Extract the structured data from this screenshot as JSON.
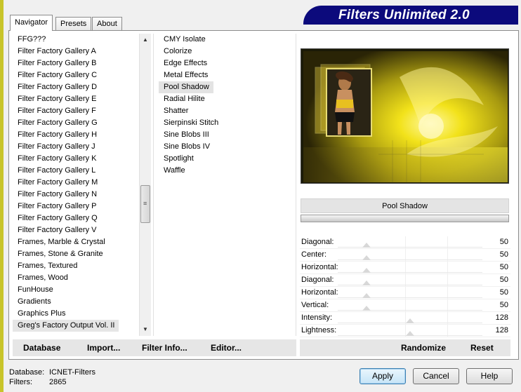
{
  "tabs": [
    "Navigator",
    "Presets",
    "About"
  ],
  "active_tab": "Navigator",
  "title": "Filters Unlimited 2.0",
  "categories": [
    "FFG???",
    "Filter Factory Gallery A",
    "Filter Factory Gallery B",
    "Filter Factory Gallery C",
    "Filter Factory Gallery D",
    "Filter Factory Gallery E",
    "Filter Factory Gallery F",
    "Filter Factory Gallery G",
    "Filter Factory Gallery H",
    "Filter Factory Gallery J",
    "Filter Factory Gallery K",
    "Filter Factory Gallery L",
    "Filter Factory Gallery M",
    "Filter Factory Gallery N",
    "Filter Factory Gallery P",
    "Filter Factory Gallery Q",
    "Filter Factory Gallery V",
    "Frames, Marble & Crystal",
    "Frames, Stone & Granite",
    "Frames, Textured",
    "Frames, Wood",
    "FunHouse",
    "Gradients",
    "Graphics Plus",
    "Greg's Factory Output Vol. II"
  ],
  "selected_category": "Greg's Factory Output Vol. II",
  "filters": [
    "CMY Isolate",
    "Colorize",
    "Edge Effects",
    "Metal Effects",
    "Pool Shadow",
    "Radial Hilite",
    "Shatter",
    "Sierpinski Stitch",
    "Sine Blobs III",
    "Sine Blobs IV",
    "Spotlight",
    "Waffle"
  ],
  "selected_filter": "Pool Shadow",
  "preview_filter_name": "Pool Shadow",
  "parameters": [
    {
      "label": "Diagonal:",
      "value": "50",
      "level": 0.2
    },
    {
      "label": "Center:",
      "value": "50",
      "level": 0.2
    },
    {
      "label": "Horizontal:",
      "value": "50",
      "level": 0.2
    },
    {
      "label": "Diagonal:",
      "value": "50",
      "level": 0.2
    },
    {
      "label": "Horizontal:",
      "value": "50",
      "level": 0.2
    },
    {
      "label": "Vertical:",
      "value": "50",
      "level": 0.2
    },
    {
      "label": "Intensity:",
      "value": "128",
      "level": 0.5
    },
    {
      "label": "Lightness:",
      "value": "128",
      "level": 0.5
    }
  ],
  "left_toolbar": {
    "database": "Database",
    "import": "Import...",
    "filter_info": "Filter Info...",
    "editor": "Editor..."
  },
  "right_toolbar": {
    "randomize": "Randomize",
    "reset": "Reset"
  },
  "status": {
    "database_label": "Database:",
    "database_value": "ICNET-Filters",
    "filters_label": "Filters:",
    "filters_value": "2865"
  },
  "buttons": {
    "apply": "Apply",
    "cancel": "Cancel",
    "help": "Help"
  },
  "colors": {
    "banner": "#0c0a7c",
    "preview_yellow": "#f2e21a"
  }
}
